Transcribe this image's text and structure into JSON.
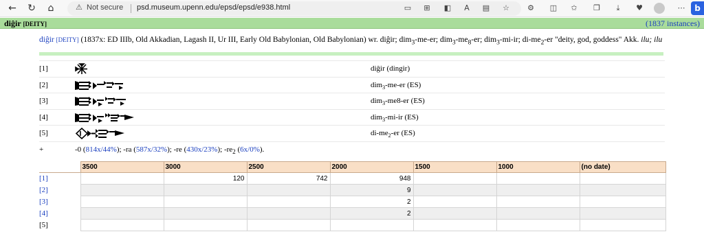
{
  "browser": {
    "security_label": "Not secure",
    "url": "psd.museum.upenn.edu/epsd/epsd/e938.html"
  },
  "header": {
    "word": "diĝir",
    "pos": "[DEITY]",
    "instances": "(1837 instances)"
  },
  "summary": {
    "word": "diĝir",
    "pos": "[DEITY]",
    "text": " (1837x: ED IIIb, Old Akkadian, Lagash II, Ur III, Early Old Babylonian, Old Babylonian) wr. diĝir; dim",
    "s1": "3",
    "t1": "-me-er; dim",
    "s2": "3",
    "t2": "-me",
    "s3": "8",
    "t3": "-er; dim",
    "s4": "3",
    "t4": "-mi-ir; di-me",
    "s5": "2",
    "t5": "-er \"deity, god, goddess\" Akk. ",
    "akk": "ilu; ilu"
  },
  "forms": [
    {
      "idx": "[1]",
      "tr_a": "diĝir (dingir)",
      "sub": "",
      "tr_b": ""
    },
    {
      "idx": "[2]",
      "tr_a": "dim",
      "sub": "3",
      "tr_b": "-me-er (ES)"
    },
    {
      "idx": "[3]",
      "tr_a": "dim",
      "sub": "3",
      "tr_b": "-me8-er (ES)"
    },
    {
      "idx": "[4]",
      "tr_a": "dim",
      "sub": "3",
      "tr_b": "-mi-ir (ES)"
    },
    {
      "idx": "[5]",
      "tr_a": "di-me",
      "sub": "2",
      "tr_b": "-er (ES)"
    }
  ],
  "plus": {
    "idx": "+",
    "p1": "-0 (",
    "l1": "814x/44%",
    "p2": "); -ra (",
    "l2": "587x/32%",
    "p3": "); -re (",
    "l3": "430x/23%",
    "p4": "); -re",
    "sub": "2",
    "p5": " (",
    "l4": "6x/0%",
    "p6": ")."
  },
  "periods": {
    "headers": [
      "3500",
      "3000",
      "2500",
      "2000",
      "1500",
      "1000",
      "(no date)"
    ],
    "rows": [
      {
        "label": "[1]",
        "cells": [
          "",
          "120",
          "742",
          "948",
          "",
          "",
          ""
        ]
      },
      {
        "label": "[2]",
        "cells": [
          "",
          "",
          "",
          "9",
          "",
          "",
          ""
        ]
      },
      {
        "label": "[3]",
        "cells": [
          "",
          "",
          "",
          "2",
          "",
          "",
          ""
        ]
      },
      {
        "label": "[4]",
        "cells": [
          "",
          "",
          "",
          "2",
          "",
          "",
          ""
        ]
      },
      {
        "label": "[5]",
        "cells": [
          "",
          "",
          "",
          "",
          "",
          "",
          ""
        ]
      }
    ]
  }
}
